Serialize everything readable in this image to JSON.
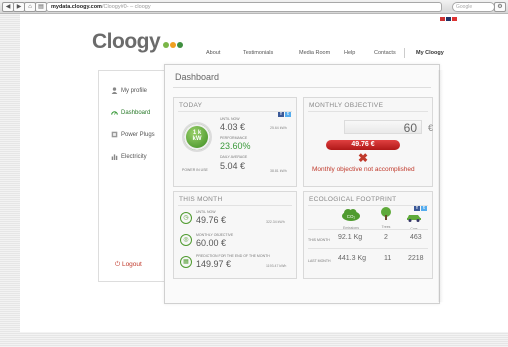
{
  "browser": {
    "url_host": "mydata.cloogy.com",
    "url_path": "/Cloogy#0- – cloogy",
    "search_placeholder": "Google"
  },
  "header": {
    "logo": "Cloogy",
    "nav": [
      "About",
      "Testimonials",
      "Media Room",
      "Help",
      "Contacts",
      "My Cloogy"
    ]
  },
  "sidebar": {
    "items": [
      {
        "label": "My profile",
        "icon": "person-icon"
      },
      {
        "label": "Dashboard",
        "icon": "gauge-icon"
      },
      {
        "label": "Power Plugs",
        "icon": "plug-icon"
      },
      {
        "label": "Electricity",
        "icon": "bar-chart-icon"
      }
    ],
    "logout": "Logout"
  },
  "dashboard": {
    "title": "Dashboard",
    "today": {
      "title": "TODAY",
      "gauge_value": "1 k",
      "gauge_unit": "kW",
      "power_in_use_label": "POWER IN USE",
      "until_now_label": "UNTIL NOW",
      "until_now_value": "4.03 €",
      "until_now_kwh": "25.64 kWh",
      "performance_label": "PERFORMANCE",
      "performance_value": "23.60%",
      "daily_average_label": "DAILY AVERAGE",
      "daily_average_value": "5.04 €",
      "daily_average_kwh": "38.81 kWh"
    },
    "monthly_objective": {
      "title": "MONTHLY OBJECTIVE",
      "target": "60",
      "currency": "€",
      "current": "49.76 €",
      "message": "Monthly objective not accomplished"
    },
    "this_month": {
      "title": "THIS MONTH",
      "until_now_label": "UNTIL NOW",
      "until_now_value": "49.76 €",
      "until_now_kwh": "322.34 kWh",
      "objective_label": "MONTHLY OBJECTIVE",
      "objective_value": "60.00 €",
      "prediction_label": "PREDICTION FOR THE END OF THE MONTH",
      "prediction_value": "149.97 €",
      "prediction_kwh": "1193.47 kWh"
    },
    "ecological": {
      "title": "ECOLOGICAL FOOTPRINT",
      "icons": [
        {
          "icon": "cloud-co2-icon",
          "label": "Emissions",
          "badge": "CO₂"
        },
        {
          "icon": "tree-icon",
          "label": "Trees"
        },
        {
          "icon": "car-icon",
          "label": "Cars"
        }
      ],
      "rows": [
        {
          "label": "THIS MONTH",
          "values": [
            "92.1 Kg",
            "2",
            "463"
          ]
        },
        {
          "label": "LAST MONTH",
          "values": [
            "441.3 Kg",
            "11",
            "2218"
          ]
        }
      ]
    }
  }
}
